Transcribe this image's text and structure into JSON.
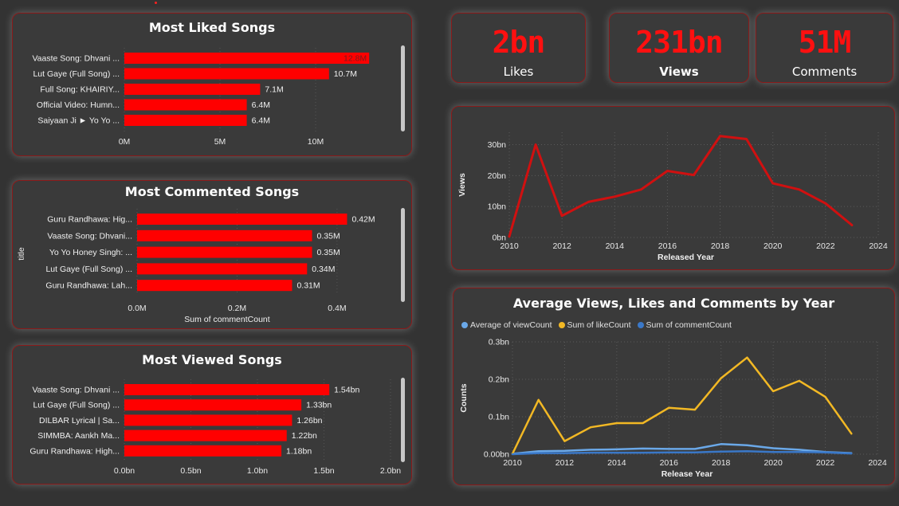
{
  "kpis": [
    {
      "value": "2bn",
      "label": "Likes"
    },
    {
      "value": "231bn",
      "label": "Views"
    },
    {
      "value": "51M",
      "label": "Comments"
    }
  ],
  "colors": {
    "bar": "#ff0000",
    "line_red": "#d01010",
    "views_line": "#6aa8e8",
    "likes_line": "#f2b824",
    "comments_line": "#3a78c8"
  },
  "chart_data": [
    {
      "id": "liked",
      "type": "bar",
      "orientation": "horizontal",
      "title": "Most Liked Songs",
      "categories": [
        "Vaaste Song: Dhvani ...",
        "Lut Gaye (Full Song) ...",
        "Full Song: KHAIRIY...",
        "Official Video: Humn...",
        "Saiyaan Ji ► Yo Yo ..."
      ],
      "values": [
        12.8,
        10.7,
        7.1,
        6.4,
        6.4
      ],
      "labels": [
        "12.8M",
        "10.7M",
        "7.1M",
        "6.4M",
        "6.4M"
      ],
      "xticks": [
        "0M",
        "5M",
        "10M"
      ],
      "xtick_values": [
        0,
        5,
        10
      ],
      "xlim": [
        0,
        13.5
      ],
      "xlabel": "",
      "ylabel": ""
    },
    {
      "id": "commented",
      "type": "bar",
      "orientation": "horizontal",
      "title": "Most Commented Songs",
      "categories": [
        "Guru Randhawa: Hig...",
        "Vaaste Song: Dhvani...",
        "Yo Yo Honey Singh: ...",
        "Lut Gaye (Full Song) ...",
        "Guru Randhawa: Lah..."
      ],
      "values": [
        0.42,
        0.35,
        0.35,
        0.34,
        0.31
      ],
      "labels": [
        "0.42M",
        "0.35M",
        "0.35M",
        "0.34M",
        "0.31M"
      ],
      "xticks": [
        "0.0M",
        "0.2M",
        "0.4M"
      ],
      "xtick_values": [
        0,
        0.2,
        0.4
      ],
      "xlim": [
        0,
        0.44
      ],
      "xlabel": "Sum of commentCount",
      "ylabel": "title"
    },
    {
      "id": "viewed",
      "type": "bar",
      "orientation": "horizontal",
      "title": "Most Viewed Songs",
      "categories": [
        "Vaaste Song: Dhvani ...",
        "Lut Gaye (Full Song) ...",
        "DILBAR Lyrical | Sa...",
        "SIMMBA: Aankh Ma...",
        "Guru Randhawa: High..."
      ],
      "values": [
        1.54,
        1.33,
        1.26,
        1.22,
        1.18
      ],
      "labels": [
        "1.54bn",
        "1.33bn",
        "1.26bn",
        "1.22bn",
        "1.18bn"
      ],
      "xticks": [
        "0.0bn",
        "0.5bn",
        "1.0bn",
        "1.5bn",
        "2.0bn"
      ],
      "xtick_values": [
        0,
        0.5,
        1.0,
        1.5,
        2.0
      ],
      "xlim": [
        0,
        2.0
      ],
      "xlabel": "",
      "ylabel": ""
    },
    {
      "id": "views_year",
      "type": "line",
      "title": "",
      "x": [
        2010,
        2011,
        2012,
        2013,
        2014,
        2015,
        2016,
        2017,
        2018,
        2019,
        2020,
        2021,
        2022,
        2023
      ],
      "series": [
        {
          "values": [
            0.3,
            30,
            7,
            11.5,
            13.2,
            15.5,
            21.5,
            20.2,
            32.8,
            31.8,
            17.5,
            15.5,
            11,
            4
          ]
        }
      ],
      "xticks": [
        "2010",
        "2012",
        "2014",
        "2016",
        "2018",
        "2020",
        "2022",
        "2024"
      ],
      "xtick_values": [
        2010,
        2012,
        2014,
        2016,
        2018,
        2020,
        2022,
        2024
      ],
      "yticks": [
        "0bn",
        "10bn",
        "20bn",
        "30bn"
      ],
      "ytick_values": [
        0,
        10,
        20,
        30
      ],
      "xlim": [
        2010,
        2024
      ],
      "ylim": [
        0,
        34
      ],
      "xlabel": "Released Year",
      "ylabel": "Views",
      "grid": true
    },
    {
      "id": "avg_year",
      "type": "line",
      "title": "Average Views, Likes and Comments by Year",
      "x": [
        2010,
        2011,
        2012,
        2013,
        2014,
        2015,
        2016,
        2017,
        2018,
        2019,
        2020,
        2021,
        2022,
        2023
      ],
      "series": [
        {
          "name": "Average of viewCount",
          "values": [
            0.001,
            0.008,
            0.009,
            0.012,
            0.013,
            0.015,
            0.014,
            0.014,
            0.027,
            0.024,
            0.016,
            0.012,
            0.006,
            0.003
          ]
        },
        {
          "name": "Sum of likeCount",
          "values": [
            0.001,
            0.145,
            0.035,
            0.072,
            0.083,
            0.083,
            0.124,
            0.119,
            0.203,
            0.258,
            0.168,
            0.196,
            0.153,
            0.055
          ]
        },
        {
          "name": "Sum of commentCount",
          "values": [
            0.0,
            0.003,
            0.003,
            0.004,
            0.004,
            0.004,
            0.005,
            0.005,
            0.007,
            0.008,
            0.006,
            0.006,
            0.005,
            0.002
          ]
        }
      ],
      "xticks": [
        "2010",
        "2012",
        "2014",
        "2016",
        "2018",
        "2020",
        "2022",
        "2024"
      ],
      "xtick_values": [
        2010,
        2012,
        2014,
        2016,
        2018,
        2020,
        2022,
        2024
      ],
      "yticks": [
        "0.00bn",
        "0.1bn",
        "0.2bn",
        "0.3bn"
      ],
      "ytick_values": [
        0,
        0.1,
        0.2,
        0.3
      ],
      "xlim": [
        2010,
        2024
      ],
      "ylim": [
        0,
        0.3
      ],
      "xlabel": "Release Year",
      "ylabel": "Counts",
      "legend": "top-left",
      "grid": true
    }
  ]
}
